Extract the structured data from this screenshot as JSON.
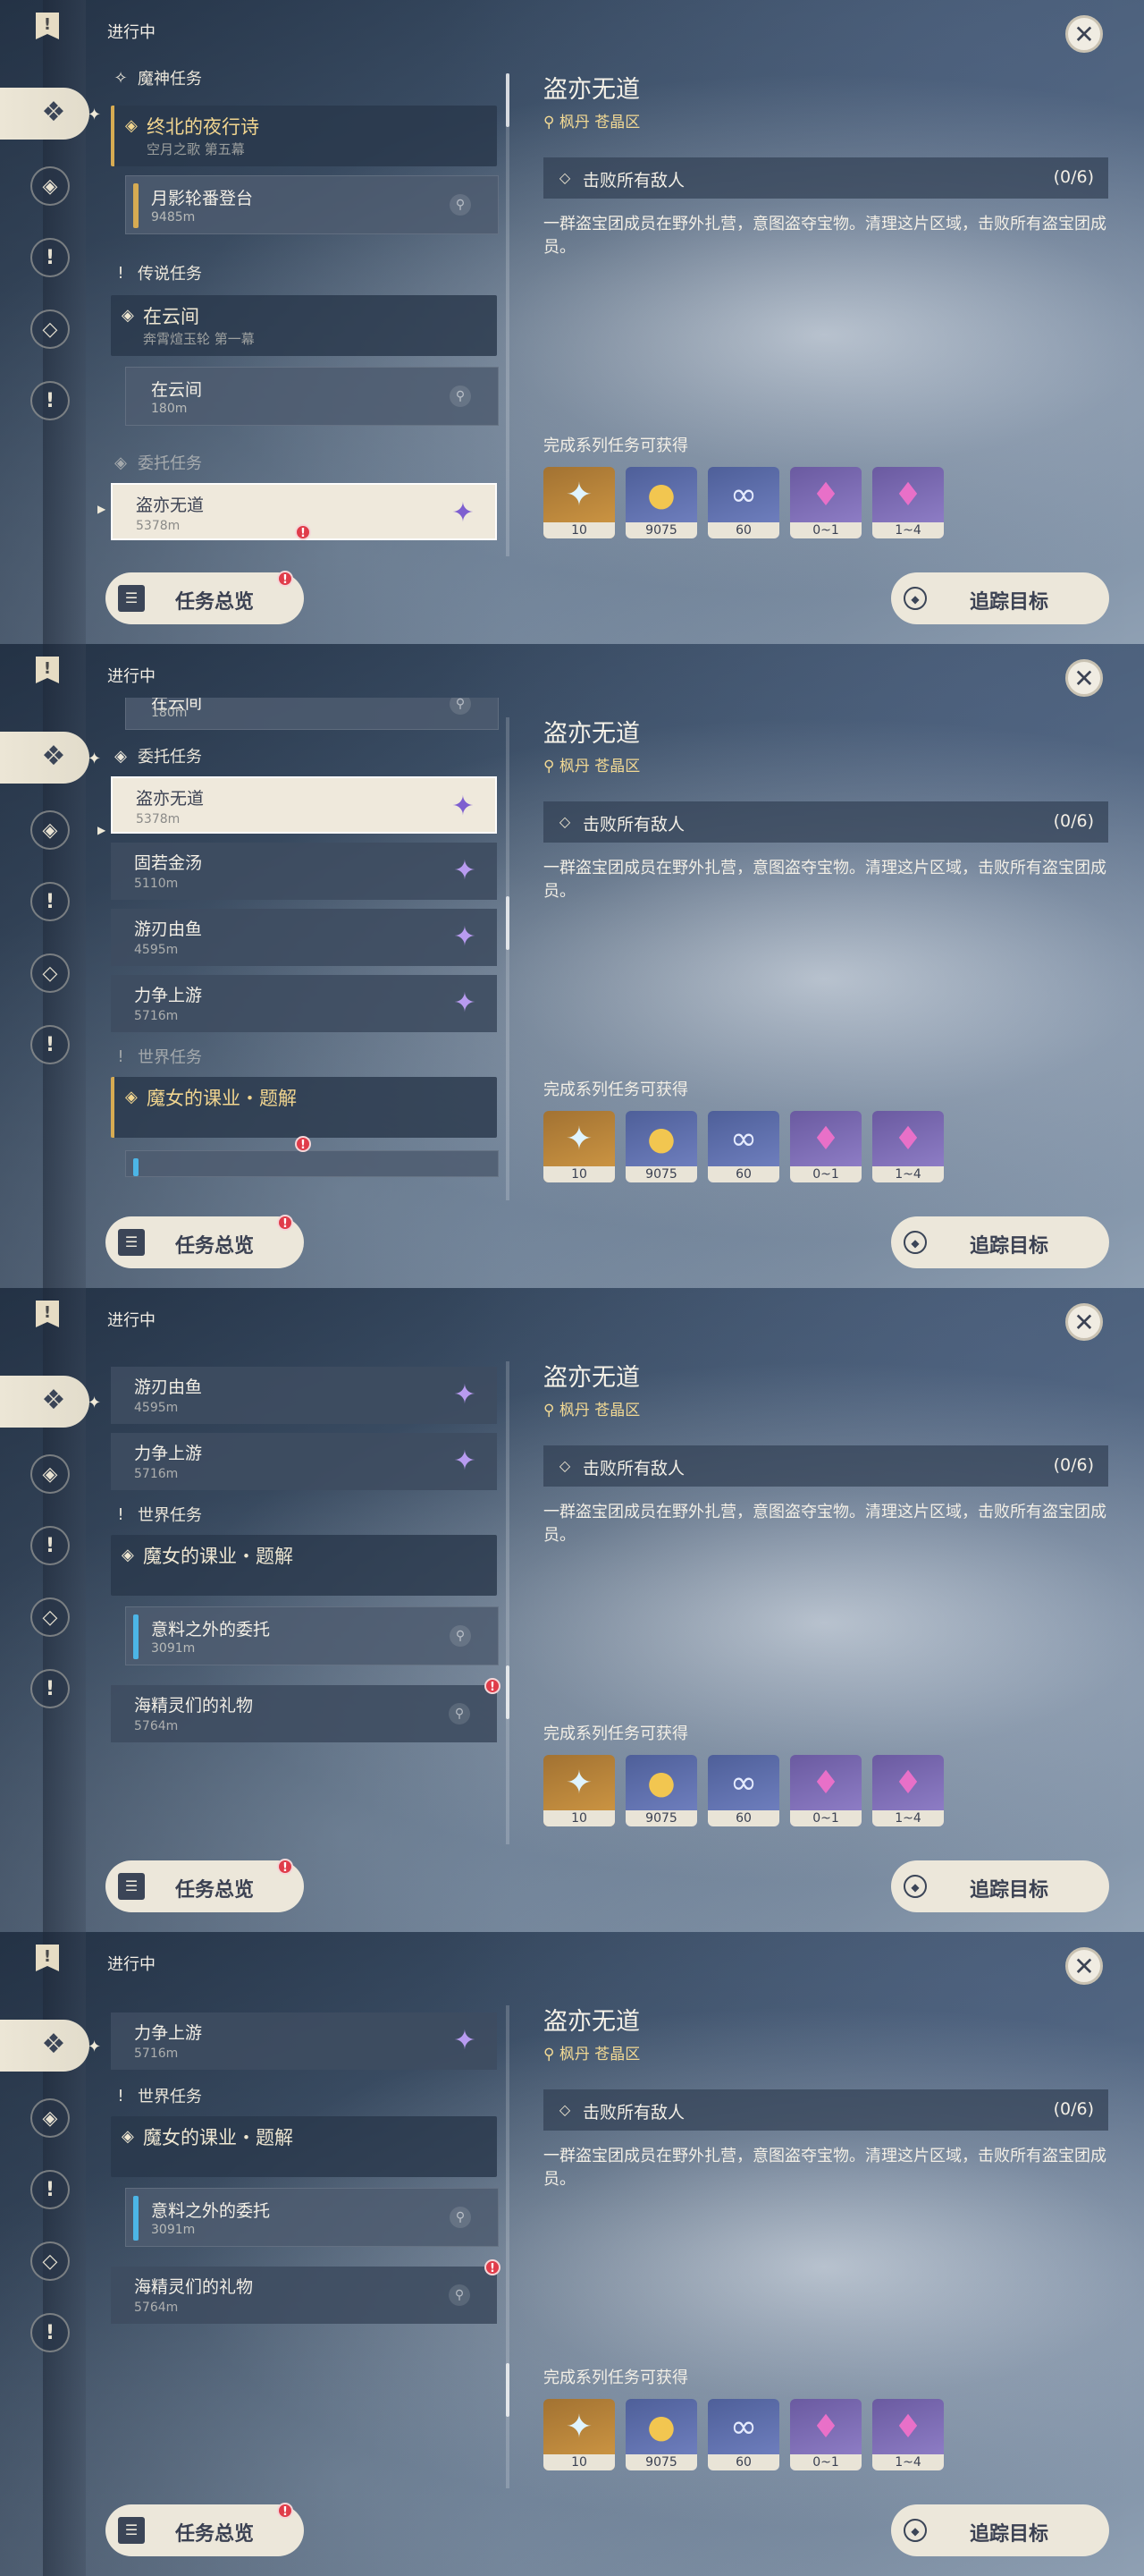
{
  "common": {
    "header_in_progress": "进行中",
    "categories": {
      "archon": "魔神任务",
      "legend": "传说任务",
      "commission": "委托任务",
      "world": "世界任务"
    },
    "quests": {
      "archon_title": "终北的夜行诗",
      "archon_subtitle": "空月之歌 第五幕",
      "archon_step": "月影轮番登台",
      "archon_step_distance": "9485m",
      "legend_title": "在云间",
      "legend_subtitle": "奔霄煊玉轮 第一幕",
      "legend_step": "在云间",
      "legend_step_distance": "180m",
      "world_title": "魔女的课业・题解",
      "world_step1": "意料之外的委托",
      "world_step1_distance": "3091m",
      "world_step2": "海精灵们的礼物",
      "world_step2_distance": "5764m"
    },
    "commissions": [
      {
        "name": "盗亦无道",
        "distance": "5378m"
      },
      {
        "name": "固若金汤",
        "distance": "5110m"
      },
      {
        "name": "游刃由鱼",
        "distance": "4595m"
      },
      {
        "name": "力争上游",
        "distance": "5716m"
      }
    ],
    "detail": {
      "title": "盗亦无道",
      "location": "枫丹 苍晶区",
      "objective": "击败所有敌人",
      "progress": "(0/6)",
      "description": "一群盗宝团成员在野外扎营，意图盗夺宝物。清理这片区域，击败所有盗宝团成员。",
      "rewards_label": "完成系列任务可获得",
      "rewards": [
        {
          "icon": "primogem-icon",
          "count": "10"
        },
        {
          "icon": "mora-icon",
          "count": "9075"
        },
        {
          "icon": "fate-icon",
          "count": "60"
        },
        {
          "icon": "crystal-icon",
          "count": "0~1"
        },
        {
          "icon": "crystal-cluster-icon",
          "count": "1~4"
        }
      ]
    },
    "buttons": {
      "overview": "任务总览",
      "track": "追踪目标"
    },
    "alert_mark": "!",
    "close_glyph": "✕"
  }
}
